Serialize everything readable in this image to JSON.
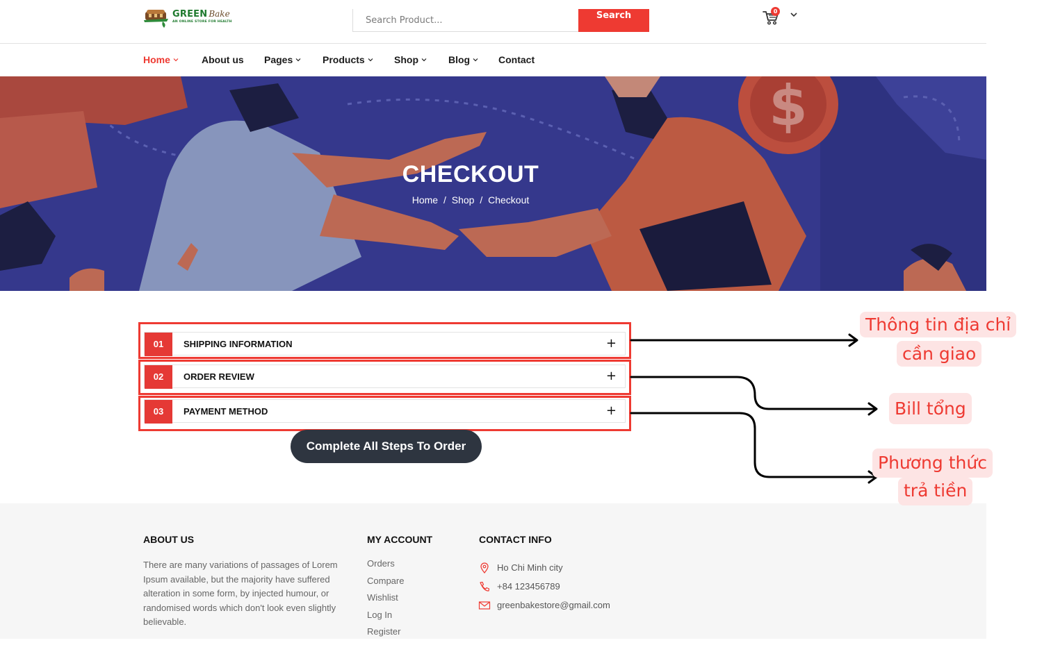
{
  "header": {
    "logo": {
      "brand": "GREEN",
      "script": "Bake",
      "tagline": "AN ONLINE STORE FOR HEALTH"
    },
    "search": {
      "placeholder": "Search Product...",
      "button_label": "Search"
    },
    "cart": {
      "count": "0"
    }
  },
  "nav": {
    "items": [
      {
        "label": "Home",
        "dropdown": true,
        "active": true
      },
      {
        "label": "About us",
        "dropdown": false
      },
      {
        "label": "Pages",
        "dropdown": true
      },
      {
        "label": "Products",
        "dropdown": true
      },
      {
        "label": "Shop",
        "dropdown": true
      },
      {
        "label": "Blog",
        "dropdown": true
      },
      {
        "label": "Contact",
        "dropdown": false
      }
    ]
  },
  "hero": {
    "title": "CHECKOUT",
    "breadcrumb": [
      "Home",
      "Shop",
      "Checkout"
    ],
    "separator": "/"
  },
  "checkout": {
    "steps": [
      {
        "number": "01",
        "label": "SHIPPING INFORMATION",
        "toggle": "+"
      },
      {
        "number": "02",
        "label": "ORDER REVIEW",
        "toggle": "+"
      },
      {
        "number": "03",
        "label": "PAYMENT METHOD",
        "toggle": "+"
      }
    ],
    "submit_label": "Complete All Steps To Order"
  },
  "footer": {
    "about": {
      "heading": "ABOUT US",
      "text": "There are many variations of passages of Lorem Ipsum available, but the majority have suffered alteration in some form, by injected humour, or randomised words which don't look even slightly believable."
    },
    "account": {
      "heading": "MY ACCOUNT",
      "links": [
        "Orders",
        "Compare",
        "Wishlist",
        "Log In",
        "Register"
      ]
    },
    "contact": {
      "heading": "CONTACT INFO",
      "address": "Ho Chi Minh city",
      "phone": "+84 123456789",
      "email": "greenbakestore@gmail.com"
    }
  },
  "annotations": {
    "shipping": [
      "Thông tin địa chỉ",
      "cần giao"
    ],
    "review": [
      "Bill tổng"
    ],
    "payment": [
      "Phương thức",
      "trả tiền"
    ]
  },
  "colors": {
    "accent": "#ee3a32",
    "hero_bg": "#3a3f9a",
    "button_dark": "#2e3540",
    "footer_bg": "#f6f6f6",
    "callout_bg": "#fde4e4"
  }
}
